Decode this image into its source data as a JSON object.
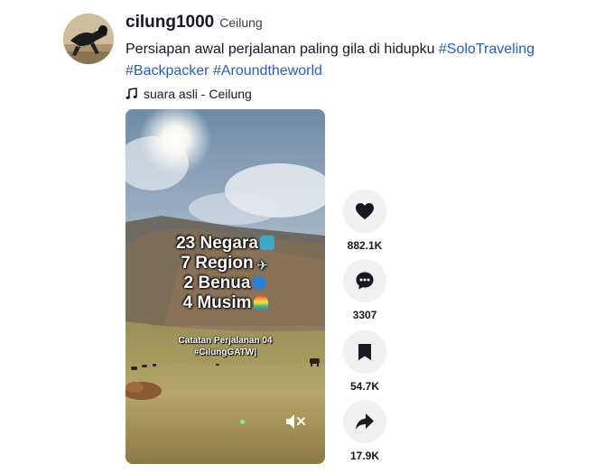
{
  "author": {
    "username": "cilung1000",
    "nickname": "Ceilung"
  },
  "caption": {
    "text": "Persiapan awal perjalanan paling gila di hidupku ",
    "hashtags": [
      "#SoloTraveling",
      "#Backpacker",
      "#Aroundtheworld"
    ]
  },
  "music": {
    "icon": "music-note-icon",
    "label": "suara asli - Ceilung"
  },
  "video": {
    "overlay_lines": [
      "23 Negara",
      "7 Region",
      "2 Benua",
      "4 Musim"
    ],
    "overlay_emojis": [
      "map-emoji",
      "airplane-emoji",
      "globe-emoji",
      "rainbow-emoji"
    ],
    "subtitle_line1": "Catatan Perjalanan 04",
    "subtitle_line2": "#CilungGATW|",
    "muted": true
  },
  "actions": {
    "like": {
      "icon": "heart-icon",
      "count": "882.1K"
    },
    "comment": {
      "icon": "comment-icon",
      "count": "3307"
    },
    "save": {
      "icon": "bookmark-icon",
      "count": "54.7K"
    },
    "share": {
      "icon": "share-icon",
      "count": "17.9K"
    }
  },
  "colors": {
    "hashtag": "#2b5db9",
    "action_bg": "#f1f1f2",
    "text": "#161823"
  }
}
